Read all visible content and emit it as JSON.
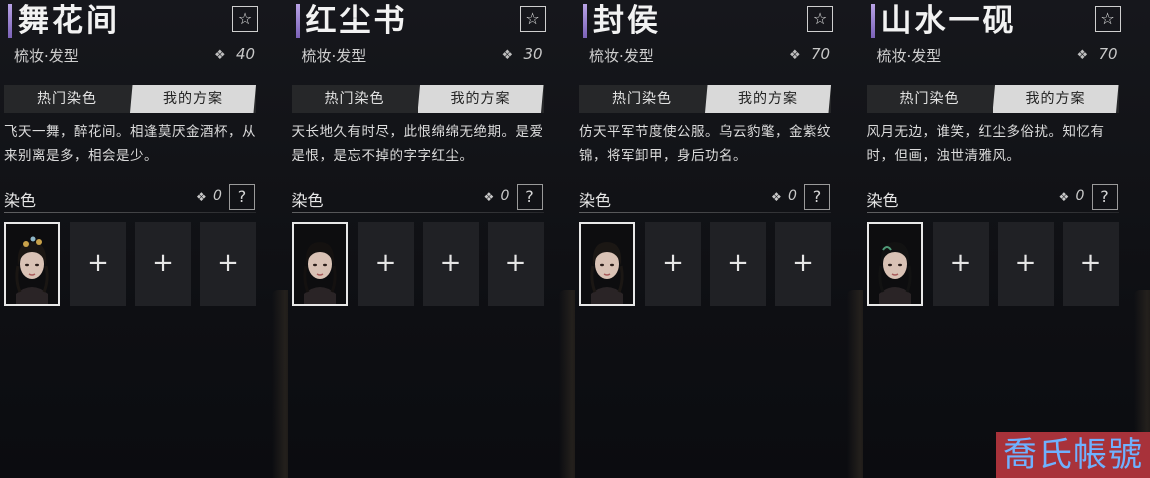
{
  "panels": [
    {
      "title": "舞花间",
      "category": "梳妆·发型",
      "cost": "40",
      "tabs": [
        "热门染色",
        "我的方案"
      ],
      "active_tab": 1,
      "description": "飞天一舞，醉花间。相逢莫厌金酒杯，从来别离是多，相会是少。",
      "dye_label": "染色",
      "dye_count": "0"
    },
    {
      "title": "红尘书",
      "category": "梳妆·发型",
      "cost": "30",
      "tabs": [
        "热门染色",
        "我的方案"
      ],
      "active_tab": 1,
      "description": "天长地久有时尽，此恨绵绵无绝期。是爱是恨，是忘不掉的字字红尘。",
      "dye_label": "染色",
      "dye_count": "0"
    },
    {
      "title": "封侯",
      "category": "梳妆·发型",
      "cost": "70",
      "tabs": [
        "热门染色",
        "我的方案"
      ],
      "active_tab": 1,
      "description": "仿天平军节度使公服。乌云豹氅，金紫纹锦，将军卸甲，身后功名。",
      "dye_label": "染色",
      "dye_count": "0"
    },
    {
      "title": "山水一砚",
      "category": "梳妆·发型",
      "cost": "70",
      "tabs": [
        "热门染色",
        "我的方案"
      ],
      "active_tab": 1,
      "description": "风月无边，谁笑，红尘多俗扰。知忆有时，但画，浊世清雅风。",
      "dye_label": "染色",
      "dye_count": "0"
    }
  ],
  "icons": {
    "favorite": "star-outline-icon",
    "cost": "ornament-currency-icon",
    "help": "question-icon",
    "add_slot": "plus-icon"
  },
  "watermark": "喬氏帳號",
  "colors": {
    "accent_bar": "#9b84d6",
    "active_tab_bg": "#d9d9d9",
    "watermark_bg": "#a8323a",
    "watermark_text": "#6fb1ff"
  }
}
